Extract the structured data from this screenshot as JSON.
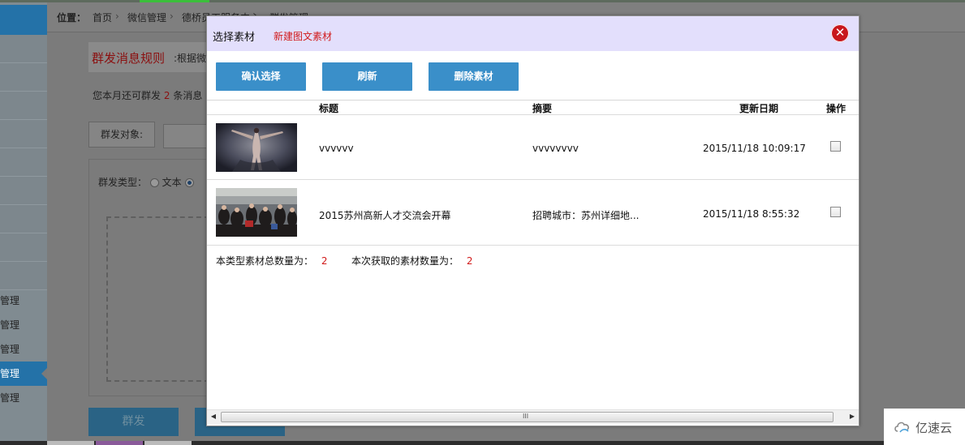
{
  "background": {
    "breadcrumb": {
      "label": "位置：",
      "home": "首页",
      "section": "微信管理",
      "current": "德桥员工服务中心 - 群发管理"
    },
    "rules_title": "群发消息规则",
    "rules_text": ":根据微",
    "quota_prefix": "您本月还可群发",
    "quota_count": "2",
    "quota_suffix": "条消息",
    "target_label": "群发对象:",
    "type_label": "群发类型：",
    "type_text_option": "文本",
    "send_button": "群发",
    "sidebar_items": [
      "管理",
      "管理",
      "管理",
      "管理",
      "管理"
    ]
  },
  "modal": {
    "title": "选择素材",
    "new_link": "新建图文素材",
    "close_icon": "close-icon",
    "buttons": {
      "confirm": "确认选择",
      "refresh": "刷新",
      "delete": "删除素材"
    },
    "columns": {
      "title": "标题",
      "summary": "摘要",
      "updated": "更新日期",
      "action": "操作"
    },
    "rows": [
      {
        "title": "vvvvvv",
        "summary": "vvvvvvvv",
        "updated": "2015/11/18 10:09:17",
        "thumb": "dancer-photo"
      },
      {
        "title": "2015苏州高新人才交流会开幕",
        "summary": "招聘城市：苏州详细地...",
        "updated": "2015/11/18 8:55:32",
        "thumb": "crowd-photo"
      }
    ],
    "summary": {
      "total_label": "本类型素材总数量为：",
      "total_value": "2",
      "fetched_label": "本次获取的素材数量为：",
      "fetched_value": "2"
    },
    "scroll_grip": "III"
  },
  "watermark": "亿速云",
  "colors": {
    "header_bg": "#e3dffc",
    "button": "#3a8fc9",
    "accent_red": "#d11a1a",
    "close": "#c8181d"
  }
}
